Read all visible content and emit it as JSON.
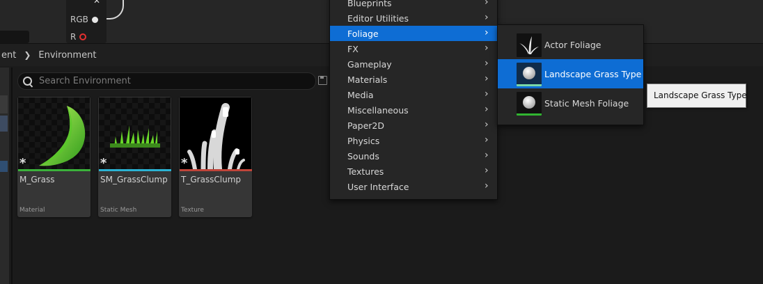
{
  "node": {
    "pins": [
      {
        "label": "RGB",
        "color": "#e6e6e6"
      },
      {
        "label": "R",
        "color": "#e53030"
      }
    ]
  },
  "breadcrumb": {
    "items": [
      "ent",
      "Environment"
    ]
  },
  "search": {
    "placeholder": "Search Environment",
    "value": ""
  },
  "assets": [
    {
      "name": "M_Grass",
      "type": "Material",
      "type_color": "#3bb23b"
    },
    {
      "name": "SM_GrassClump",
      "type": "Static Mesh",
      "type_color": "#2bb3d4"
    },
    {
      "name": "T_GrassClump",
      "type": "Texture",
      "type_color": "#c0453a"
    }
  ],
  "menu": {
    "items": [
      {
        "label": "Blueprints"
      },
      {
        "label": "Editor Utilities"
      },
      {
        "label": "Foliage",
        "active": true
      },
      {
        "label": "FX"
      },
      {
        "label": "Gameplay"
      },
      {
        "label": "Materials"
      },
      {
        "label": "Media"
      },
      {
        "label": "Miscellaneous"
      },
      {
        "label": "Paper2D"
      },
      {
        "label": "Physics"
      },
      {
        "label": "Sounds"
      },
      {
        "label": "Textures"
      },
      {
        "label": "User Interface"
      }
    ]
  },
  "submenu": {
    "items": [
      {
        "label": "Actor Foliage",
        "icon": "actor-foliage-icon"
      },
      {
        "label": "Landscape Grass Type",
        "icon": "landscape-grass-type-icon",
        "bar_color": "#7ad9a8",
        "active": true
      },
      {
        "label": "Static Mesh Foliage",
        "icon": "static-mesh-foliage-icon",
        "bar_color": "#31b531"
      }
    ]
  },
  "tooltip": {
    "text": "Landscape Grass Type"
  },
  "colors": {
    "accent": "#0e6dd4"
  }
}
